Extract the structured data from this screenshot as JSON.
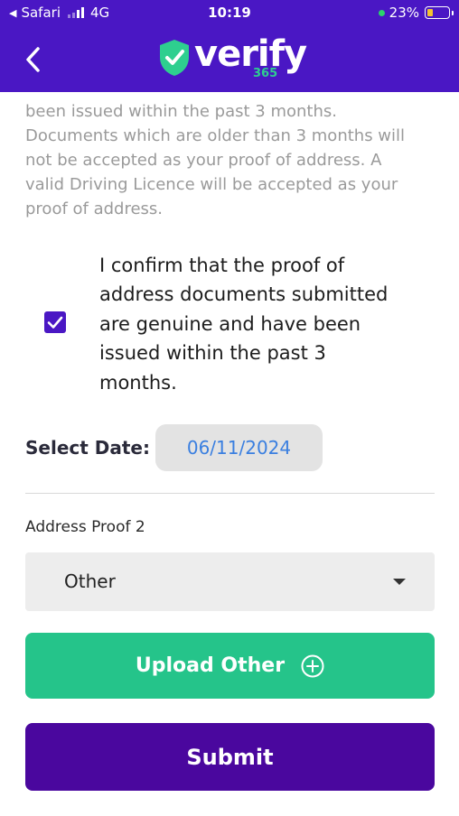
{
  "status_bar": {
    "carrier": "Safari",
    "network": "4G",
    "time": "10:19",
    "battery_percent": "23%",
    "back_arrow": "◀"
  },
  "header": {
    "logo_text": "verify",
    "logo_subtext": "365",
    "back_icon": "chevron-left-icon",
    "background_color": "#4a17c4"
  },
  "intro_text": {
    "line_1": "been issued within the past 3 months.",
    "line_2": "Documents which are older than 3 months will",
    "line_3": "not be accepted as your proof of address. A",
    "line_4": "valid Driving Licence will be accepted as your",
    "line_5": "proof of address."
  },
  "confirmation": {
    "checked": true,
    "line_1": "I confirm that the proof of",
    "line_2": "address documents submitted",
    "line_3": "are genuine and have been",
    "line_4": "issued within the past 3",
    "line_5": "months."
  },
  "date": {
    "label": "Select Date:",
    "value": "06/11/2024"
  },
  "address_proof": {
    "label": "Address Proof 2",
    "selected": "Other"
  },
  "buttons": {
    "upload_label": "Upload Other",
    "submit_label": "Submit",
    "upload_color": "#25c48a",
    "submit_color": "#4a079e"
  }
}
